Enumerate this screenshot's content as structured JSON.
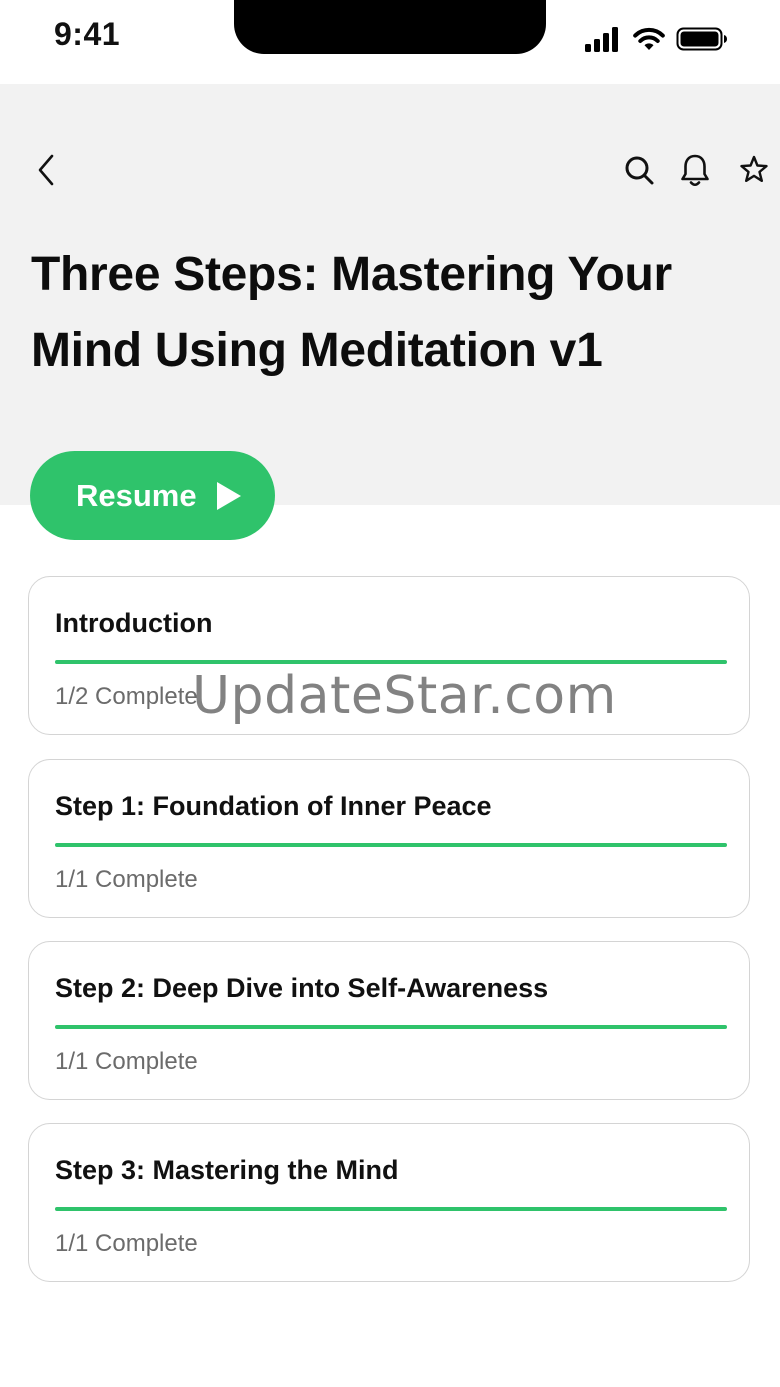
{
  "status_bar": {
    "time": "9:41",
    "icons": [
      "cellular-signal-icon",
      "wifi-icon",
      "battery-icon"
    ]
  },
  "nav": {
    "back_icon": "chevron-left-icon",
    "actions": [
      "search-icon",
      "bell-icon",
      "star-icon"
    ]
  },
  "page": {
    "title_line1": "Three Steps: Mastering Your",
    "title_line2": "Mind Using Meditation v1"
  },
  "resume_button": {
    "label": "Resume",
    "icon": "play-icon"
  },
  "sections": [
    {
      "title": "Introduction",
      "status": "1/2 Complete",
      "progress": 1.0
    },
    {
      "title": "Step 1: Foundation of Inner Peace",
      "status": "1/1 Complete",
      "progress": 1.0
    },
    {
      "title": "Step 2: Deep Dive into Self-Awareness",
      "status": "1/1 Complete",
      "progress": 1.0
    },
    {
      "title": "Step 3: Mastering the Mind",
      "status": "1/1 Complete",
      "progress": 1.0
    }
  ],
  "watermark": "UpdateStar.com",
  "colors": {
    "accent": "#2fc36b",
    "header_bg": "#f2f2f2",
    "card_border": "#d4d4d4",
    "muted_text": "#6b6b6b"
  }
}
